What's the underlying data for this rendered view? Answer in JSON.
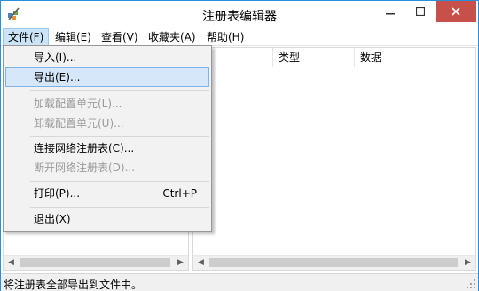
{
  "window": {
    "title": "注册表编辑器"
  },
  "menubar": {
    "items": [
      {
        "label": "文件(F)"
      },
      {
        "label": "编辑(E)"
      },
      {
        "label": "查看(V)"
      },
      {
        "label": "收藏夹(A)"
      },
      {
        "label": "帮助(H)"
      }
    ],
    "active_index": 0
  },
  "file_menu": {
    "items": [
      {
        "label": "导入(I)...",
        "enabled": true
      },
      {
        "label": "导出(E)...",
        "enabled": true,
        "highlighted": true
      },
      {
        "label": "加载配置单元(L)...",
        "enabled": false
      },
      {
        "label": "卸载配置单元(U)...",
        "enabled": false
      },
      {
        "label": "连接网络注册表(C)...",
        "enabled": true
      },
      {
        "label": "断开网络注册表(D)...",
        "enabled": false
      },
      {
        "label": "打印(P)...",
        "enabled": true,
        "shortcut": "Ctrl+P"
      },
      {
        "label": "退出(X)",
        "enabled": true
      }
    ]
  },
  "list_view": {
    "columns": [
      {
        "label": "称"
      },
      {
        "label": "类型"
      },
      {
        "label": "数据"
      }
    ]
  },
  "statusbar": {
    "text": "将注册表全部导出到文件中。"
  },
  "colors": {
    "menu_active_bg": "#cce4f7",
    "menu_highlight_bg": "#d5e7f8",
    "close_button": "#c7504a",
    "window_border": "#2b8fd8",
    "disabled_text": "#9a9a9a"
  }
}
